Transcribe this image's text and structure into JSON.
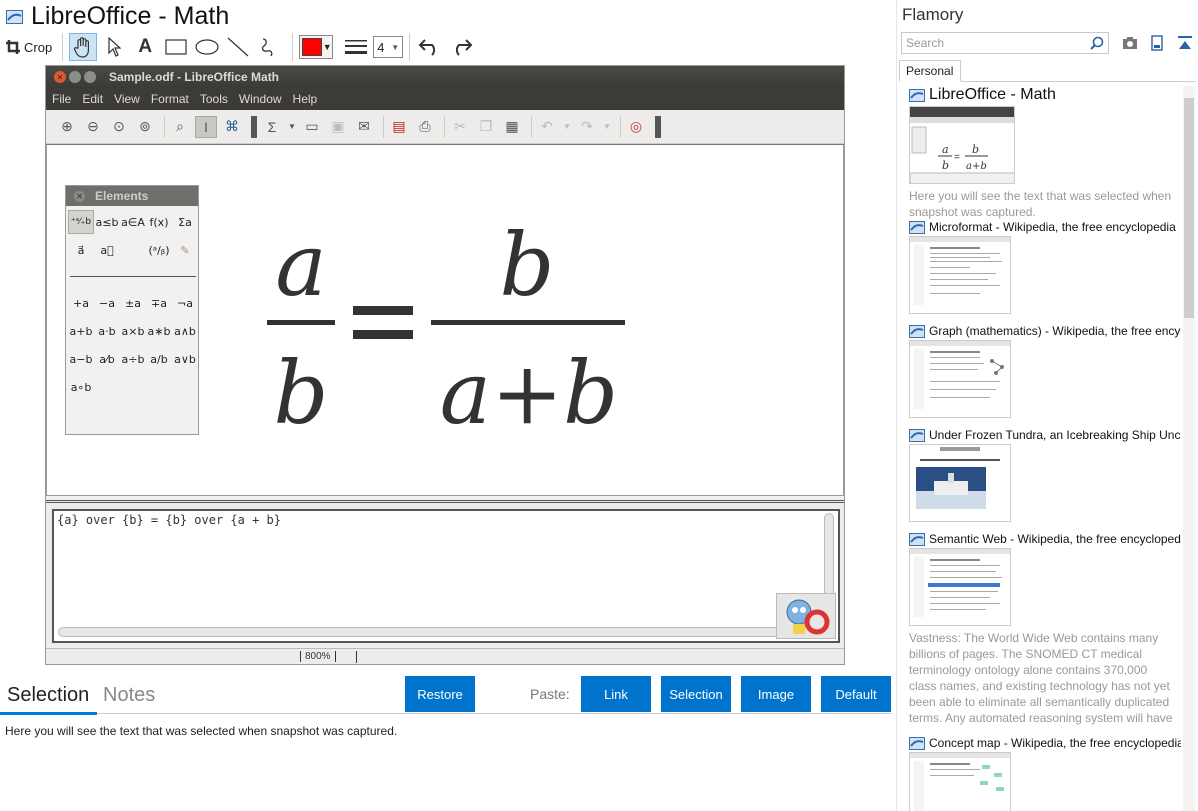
{
  "app": {
    "title": "LibreOffice - Math"
  },
  "toolbar": {
    "crop_label": "Crop",
    "line_width": "4",
    "stroke_color": "#ff0000"
  },
  "screenshot": {
    "window_title": "Sample.odf - LibreOffice Math",
    "menu": [
      "File",
      "Edit",
      "View",
      "Format",
      "Tools",
      "Window",
      "Help"
    ],
    "elements_title": "Elements",
    "elements_rows": [
      [
        "⁺ᵃ⁄₊b",
        "a≤b",
        "a∈A",
        "f(x)",
        "Σa"
      ],
      [
        "a⃗",
        "a⃞",
        "",
        "(ᵃ/ᵦ)",
        "✎"
      ],
      [
        "+a",
        "−a",
        "±a",
        "∓a",
        "¬a"
      ],
      [
        "a+b",
        "a·b",
        "a×b",
        "a∗b",
        "a∧b"
      ],
      [
        "a−b",
        "a⁄b",
        "a÷b",
        "a/b",
        "a∨b"
      ],
      [
        "a∘b",
        "",
        "",
        "",
        ""
      ]
    ],
    "formula": {
      "lhs_num": "a",
      "lhs_den": "b",
      "eq": "=",
      "rhs_num": "b",
      "rhs_den": "a+b"
    },
    "command": "{a} over {b} = {b} over {a + b}",
    "zoom": "800%"
  },
  "notes": {
    "tab_selection": "Selection",
    "tab_notes": "Notes",
    "restore": "Restore",
    "paste_label": "Paste:",
    "paste_link": "Link",
    "paste_selection": "Selection",
    "paste_image": "Image",
    "paste_default": "Default",
    "selection_text": "Here you will see the text that was selected when snapshot was captured."
  },
  "sidebar": {
    "title": "Flamory",
    "search_placeholder": "Search",
    "tab_personal": "Personal",
    "items": [
      {
        "title": "LibreOffice - Math",
        "desc": "Here you will see the text that was selected when snapshot was captured."
      },
      {
        "title": "Microformat - Wikipedia, the free encyclopedia",
        "desc": ""
      },
      {
        "title": "Graph (mathematics) - Wikipedia, the free encyclopedia",
        "desc": ""
      },
      {
        "title": "Under Frozen Tundra, an Icebreaking Ship Uncovers",
        "desc": ""
      },
      {
        "title": "Semantic Web - Wikipedia, the free encyclopedia",
        "desc": "Vastness: The World Wide Web contains many billions of pages. The SNOMED CT medical terminology ontology alone contains 370,000 class names, and existing technology has not yet been able to eliminate all semantically duplicated terms. Any automated reasoning system will have to deal with truly huge inputs."
      },
      {
        "title": "Concept map - Wikipedia, the free encyclopedia",
        "desc": ""
      }
    ]
  }
}
